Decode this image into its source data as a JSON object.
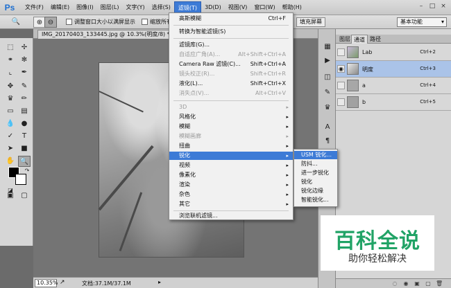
{
  "app": {
    "logo": "Ps"
  },
  "menubar": {
    "items": [
      "文件(F)",
      "编辑(E)",
      "图像(I)",
      "图层(L)",
      "文字(Y)",
      "选择(S)",
      "滤镜(T)",
      "3D(D)",
      "视图(V)",
      "窗口(W)",
      "帮助(H)"
    ],
    "active_index": 6
  },
  "optionsbar": {
    "resize_window_label": "调整窗口大小以满屏显示",
    "zoom_all_label": "缩放所有窗",
    "fill_screen_label": "填充屏幕",
    "workspace": "基本功能"
  },
  "document": {
    "tab_title": "IMG_20170403_133445.jpg @ 10.3%(明度/8) *",
    "close_glyph": "×",
    "zoom": "10.35%",
    "info": "文档:37.1M/37.1M"
  },
  "filter_menu": {
    "items": [
      {
        "label": "高斯模糊",
        "shortcut": "Ctrl+F",
        "disabled": false
      },
      {
        "label": "转换为智能滤镜(S)",
        "shortcut": "",
        "disabled": false
      },
      {
        "label": "滤镜库(G)...",
        "shortcut": "",
        "disabled": false
      },
      {
        "label": "自适应广角(A)...",
        "shortcut": "Alt+Shift+Ctrl+A",
        "disabled": true
      },
      {
        "label": "Camera Raw 滤镜(C)...",
        "shortcut": "Shift+Ctrl+A",
        "disabled": false
      },
      {
        "label": "镜头校正(R)...",
        "shortcut": "Shift+Ctrl+R",
        "disabled": true
      },
      {
        "label": "液化(L)...",
        "shortcut": "Shift+Ctrl+X",
        "disabled": false
      },
      {
        "label": "消失点(V)...",
        "shortcut": "Alt+Ctrl+V",
        "disabled": true
      },
      {
        "label": "3D",
        "shortcut": "",
        "disabled": true,
        "submenu": true
      },
      {
        "label": "风格化",
        "shortcut": "",
        "disabled": false,
        "submenu": true
      },
      {
        "label": "模糊",
        "shortcut": "",
        "disabled": false,
        "submenu": true
      },
      {
        "label": "模糊画廊",
        "shortcut": "",
        "disabled": true,
        "submenu": true
      },
      {
        "label": "扭曲",
        "shortcut": "",
        "disabled": false,
        "submenu": true
      },
      {
        "label": "锐化",
        "shortcut": "",
        "disabled": false,
        "submenu": true,
        "highlighted": true
      },
      {
        "label": "视频",
        "shortcut": "",
        "disabled": false,
        "submenu": true
      },
      {
        "label": "像素化",
        "shortcut": "",
        "disabled": false,
        "submenu": true
      },
      {
        "label": "渲染",
        "shortcut": "",
        "disabled": false,
        "submenu": true
      },
      {
        "label": "杂色",
        "shortcut": "",
        "disabled": false,
        "submenu": true
      },
      {
        "label": "其它",
        "shortcut": "",
        "disabled": false,
        "submenu": true
      },
      {
        "label": "浏览联机滤镜...",
        "shortcut": "",
        "disabled": false
      }
    ],
    "submenu_arrow": "▸"
  },
  "sharpen_submenu": {
    "items": [
      "USM 锐化...",
      "防抖...",
      "进一步锐化",
      "锐化",
      "锐化边缘",
      "智能锐化..."
    ],
    "highlighted_index": 0
  },
  "layers_panel": {
    "tabs": [
      "图层",
      "通道",
      "路径"
    ],
    "active_tab": 1,
    "channels": [
      {
        "name": "Lab",
        "shortcut": "Ctrl+2",
        "visible": true
      },
      {
        "name": "明度",
        "shortcut": "Ctrl+3",
        "visible": true,
        "selected": true
      },
      {
        "name": "a",
        "shortcut": "Ctrl+4",
        "visible": false
      },
      {
        "name": "b",
        "shortcut": "Ctrl+5",
        "visible": false
      }
    ]
  },
  "watermark": {
    "title": "百科全说",
    "subtitle": "助你轻松解决"
  },
  "colors": {
    "accent": "#3d7bd6",
    "watermark_green": "#21a366"
  }
}
